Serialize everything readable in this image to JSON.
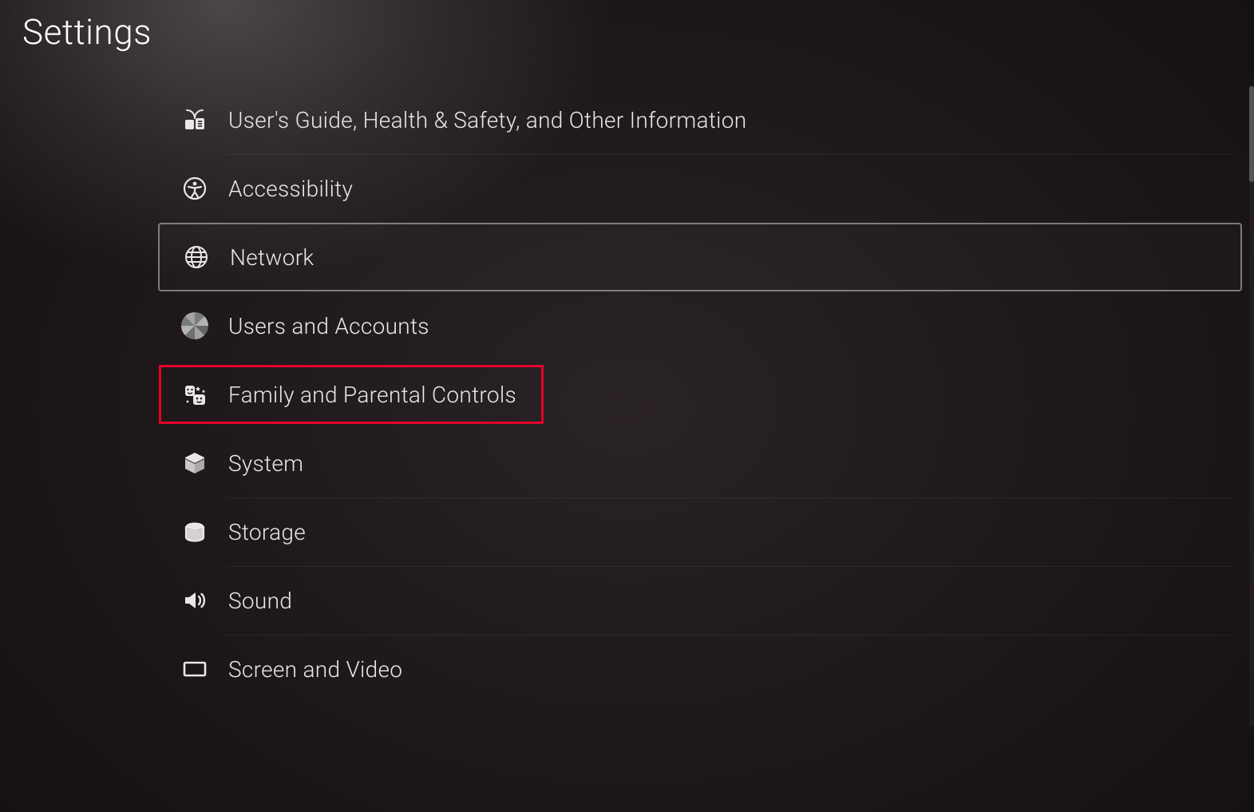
{
  "title": "Settings",
  "menu": {
    "items": [
      {
        "id": "guide",
        "label": "User's Guide, Health & Safety, and Other Information",
        "icon": "guide-icon"
      },
      {
        "id": "accessibility",
        "label": "Accessibility",
        "icon": "accessibility-icon"
      },
      {
        "id": "network",
        "label": "Network",
        "icon": "globe-icon",
        "selected": true
      },
      {
        "id": "users",
        "label": "Users and Accounts",
        "icon": "avatar-icon"
      },
      {
        "id": "family",
        "label": "Family and Parental Controls",
        "icon": "family-icon",
        "highlighted": true
      },
      {
        "id": "system",
        "label": "System",
        "icon": "cube-icon"
      },
      {
        "id": "storage",
        "label": "Storage",
        "icon": "storage-icon"
      },
      {
        "id": "sound",
        "label": "Sound",
        "icon": "sound-icon"
      },
      {
        "id": "screen",
        "label": "Screen and Video",
        "icon": "screen-icon"
      }
    ]
  },
  "highlight_color": "#e4002b"
}
